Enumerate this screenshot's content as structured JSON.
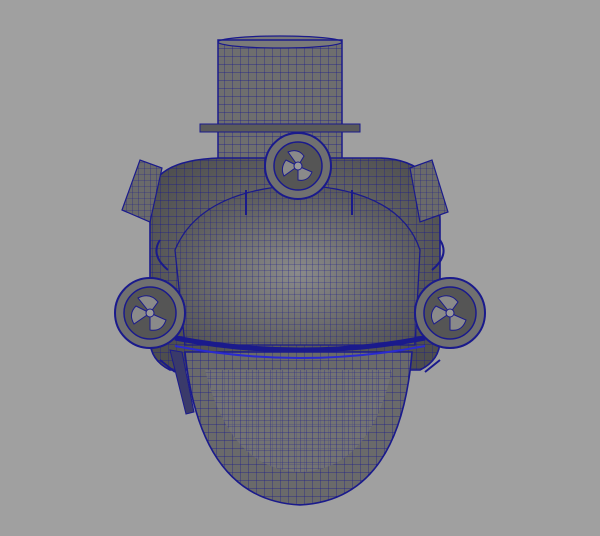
{
  "viewport": {
    "background": "#a0a0a0",
    "mesh_fill": "#6e6e6e",
    "mesh_shade": "#5a5a5a",
    "wire_color": "#1a1a8c",
    "wire_highlight": "#2a2ad0"
  },
  "model": {
    "icon": "submersible-wireframe"
  }
}
